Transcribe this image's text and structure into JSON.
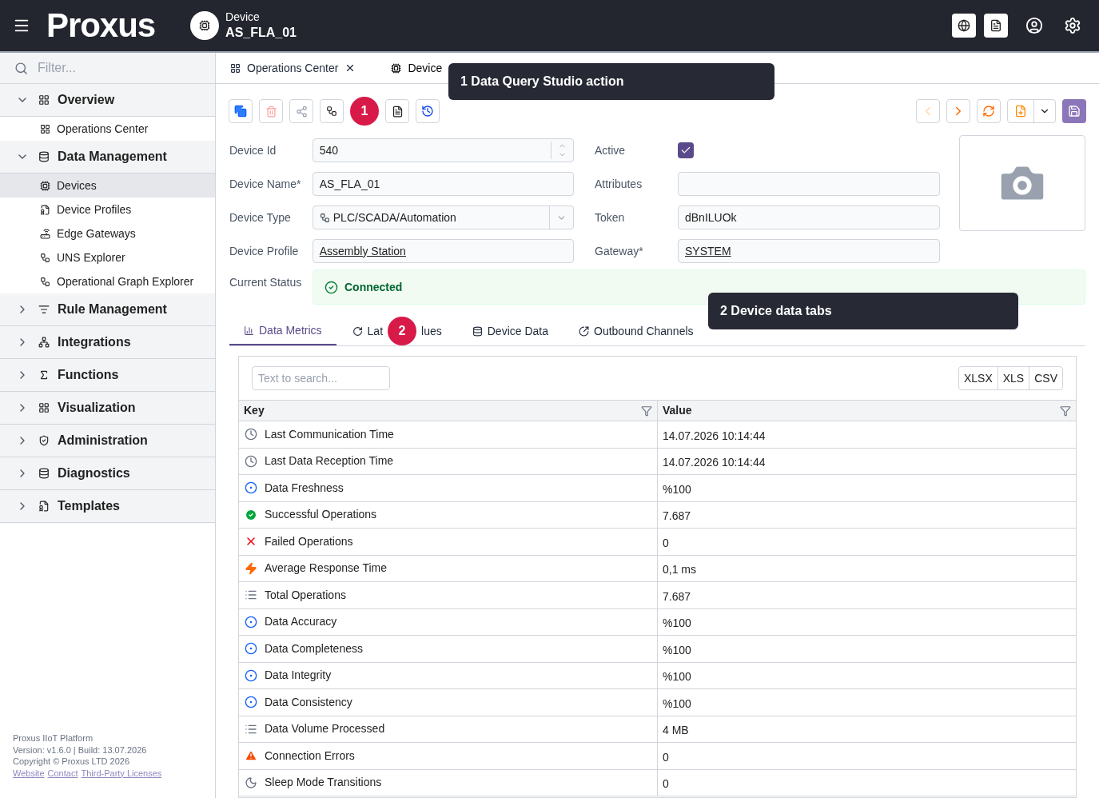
{
  "header": {
    "brand": "Proxus",
    "context_label": "Device",
    "context_value": "AS_FLA_01"
  },
  "sidebar": {
    "filter_placeholder": "Filter...",
    "groups": [
      {
        "label": "Overview",
        "expanded": true,
        "children": [
          {
            "label": "Operations Center",
            "selected": false
          }
        ]
      },
      {
        "label": "Data Management",
        "expanded": true,
        "children": [
          {
            "label": "Devices",
            "selected": true
          },
          {
            "label": "Device Profiles",
            "selected": false
          },
          {
            "label": "Edge Gateways",
            "selected": false
          },
          {
            "label": "UNS Explorer",
            "selected": false
          },
          {
            "label": "Operational Graph Explorer",
            "selected": false
          }
        ]
      },
      {
        "label": "Rule Management",
        "expanded": false
      },
      {
        "label": "Integrations",
        "expanded": false
      },
      {
        "label": "Functions",
        "expanded": false
      },
      {
        "label": "Visualization",
        "expanded": false
      },
      {
        "label": "Administration",
        "expanded": false
      },
      {
        "label": "Diagnostics",
        "expanded": false
      },
      {
        "label": "Templates",
        "expanded": false
      }
    ],
    "footer": {
      "lines": [
        "Proxus IIoT Platform",
        "Version: v1.6.0 | Build: 13.07.2026",
        "Copyright © Proxus LTD 2026"
      ],
      "links": [
        "Website",
        "Contact",
        "Third-Party Licenses"
      ]
    }
  },
  "tabs": [
    {
      "label": "Operations Center",
      "selected": false
    },
    {
      "label": "Device",
      "selected": true
    }
  ],
  "callouts": [
    {
      "badge": "1",
      "tooltip": "1 Data Query Studio action"
    },
    {
      "badge": "2",
      "tooltip": "2 Device data tabs"
    }
  ],
  "form": {
    "fields": [
      {
        "label": "Device Id",
        "kind": "spin",
        "value": "540"
      },
      {
        "label": "Active",
        "kind": "check",
        "checked": true
      },
      {
        "label": "Device Name*",
        "kind": "text",
        "value": "AS_FLA_01"
      },
      {
        "label": "Attributes",
        "kind": "text"
      },
      {
        "label": "Device Type",
        "kind": "select",
        "value": "PLC/SCADA/Automation"
      },
      {
        "label": "Token",
        "kind": "text",
        "value": "dBnILUOk"
      },
      {
        "label": "Device Profile",
        "kind": "link",
        "value": "Assembly Station"
      },
      {
        "label": "Gateway*",
        "kind": "link",
        "value": "SYSTEM"
      }
    ],
    "status_label": "Current Status",
    "status": "Connected"
  },
  "data_tabs": [
    {
      "label": "Data Metrics",
      "selected": true
    },
    {
      "label_start": "Lat",
      "label_end": "lues",
      "selected": false
    },
    {
      "label": "Device Data",
      "selected": false
    },
    {
      "label": "Outbound Channels",
      "selected": false
    }
  ],
  "grid": {
    "search_placeholder": "Text to search...",
    "exports": [
      "XLSX",
      "XLS",
      "CSV"
    ],
    "columns": [
      "Key",
      "Value"
    ],
    "rows": [
      {
        "key": "Last Communication Time",
        "value": "14.07.2026 10:14:44"
      },
      {
        "key": "Last Data Reception Time",
        "value": "14.07.2026 10:14:44"
      },
      {
        "key": "Data Freshness",
        "value": "%100"
      },
      {
        "key": "Successful Operations",
        "value": "7.687"
      },
      {
        "key": "Failed Operations",
        "value": "0"
      },
      {
        "key": "Average Response Time",
        "value": "0,1 ms"
      },
      {
        "key": "Total Operations",
        "value": "7.687"
      },
      {
        "key": "Data Accuracy",
        "value": "%100"
      },
      {
        "key": "Data Completeness",
        "value": "%100"
      },
      {
        "key": "Data Integrity",
        "value": "%100"
      },
      {
        "key": "Data Consistency",
        "value": "%100"
      },
      {
        "key": "Data Volume Processed",
        "value": "4 MB"
      },
      {
        "key": "Connection Errors",
        "value": "0"
      },
      {
        "key": "Sleep Mode Transitions",
        "value": "0"
      }
    ]
  }
}
